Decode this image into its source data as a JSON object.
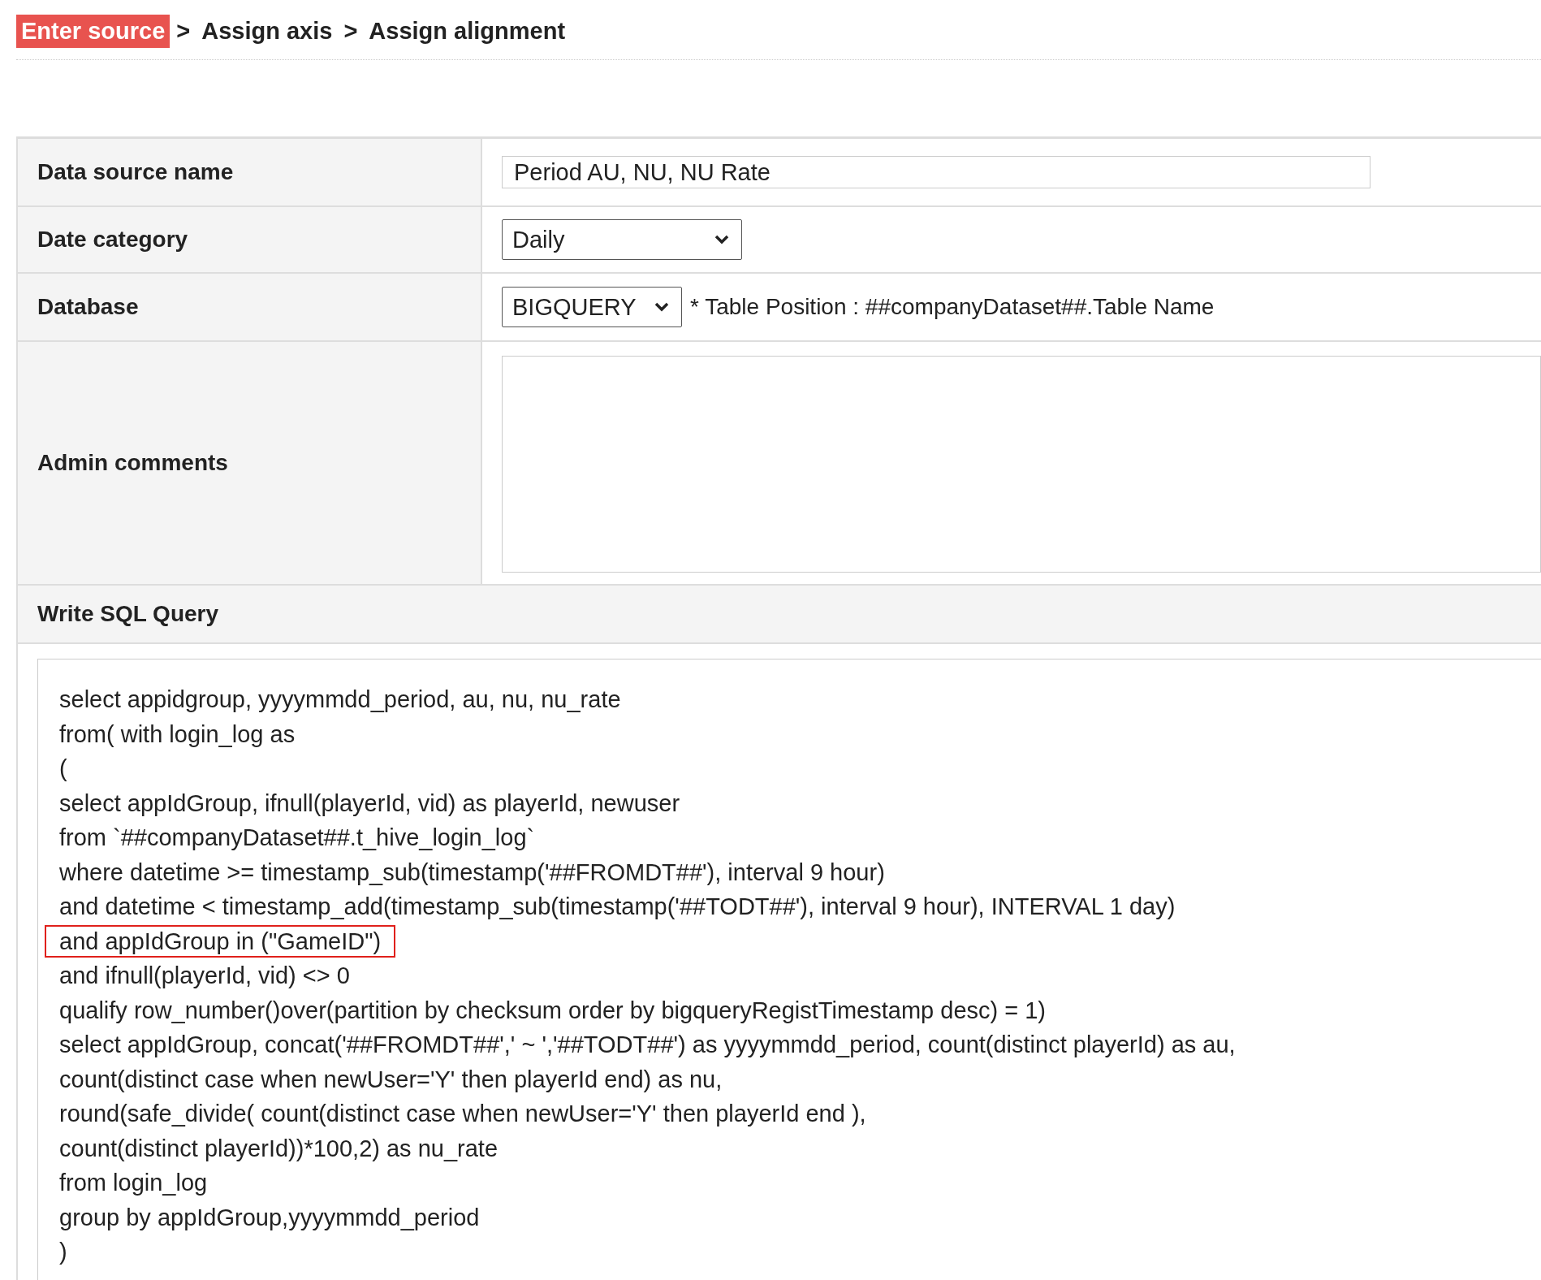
{
  "breadcrumb_separator": ">",
  "breadcrumb": [
    {
      "label": "Enter source",
      "selected": true
    },
    {
      "label": "Assign axis",
      "selected": false
    },
    {
      "label": "Assign alignment",
      "selected": false
    }
  ],
  "form": {
    "rows": [
      {
        "kind": "text",
        "label": "Data source name",
        "value": "Period AU, NU, NU Rate"
      },
      {
        "kind": "select",
        "label": "Date category",
        "value": "Daily"
      },
      {
        "kind": "select",
        "label": "Database",
        "value": "BIGQUERY",
        "note": "* Table Position : ##companyDataset##.Table Name"
      },
      {
        "kind": "textarea",
        "label": "Admin comments",
        "value": ""
      }
    ]
  },
  "sql": {
    "label": "Write SQL Query",
    "lines": [
      {
        "text": "select appidgroup, yyyymmdd_period, au, nu, nu_rate",
        "highlighted": false
      },
      {
        "text": "from( with login_log as",
        "highlighted": false
      },
      {
        "text": "(",
        "highlighted": false
      },
      {
        "text": "select appIdGroup, ifnull(playerId, vid) as playerId, newuser",
        "highlighted": false
      },
      {
        "text": "from `##companyDataset##.t_hive_login_log`",
        "highlighted": false
      },
      {
        "text": "where datetime >= timestamp_sub(timestamp('##FROMDT##'), interval 9 hour)",
        "highlighted": false
      },
      {
        "text": "and datetime < timestamp_add(timestamp_sub(timestamp('##TODT##'), interval 9 hour), INTERVAL 1 day)",
        "highlighted": false
      },
      {
        "text": "and appIdGroup in (\"GameID\")",
        "highlighted": true
      },
      {
        "text": "and ifnull(playerId, vid) <> 0",
        "highlighted": false
      },
      {
        "text": "qualify row_number()over(partition by checksum order by bigqueryRegistTimestamp desc) = 1)",
        "highlighted": false
      },
      {
        "text": "select appIdGroup, concat('##FROMDT##',' ~ ','##TODT##') as yyyymmdd_period, count(distinct playerId) as au,",
        "highlighted": false
      },
      {
        "text": "count(distinct case when newUser='Y' then playerId end) as nu,",
        "highlighted": false
      },
      {
        "text": "round(safe_divide( count(distinct case when newUser='Y' then playerId end ),",
        "highlighted": false
      },
      {
        "text": "count(distinct playerId))*100,2) as nu_rate",
        "highlighted": false
      },
      {
        "text": "from login_log",
        "highlighted": false
      },
      {
        "text": "group by appIdGroup,yyyymmdd_period",
        "highlighted": false
      },
      {
        "text": ")",
        "highlighted": false
      }
    ]
  }
}
